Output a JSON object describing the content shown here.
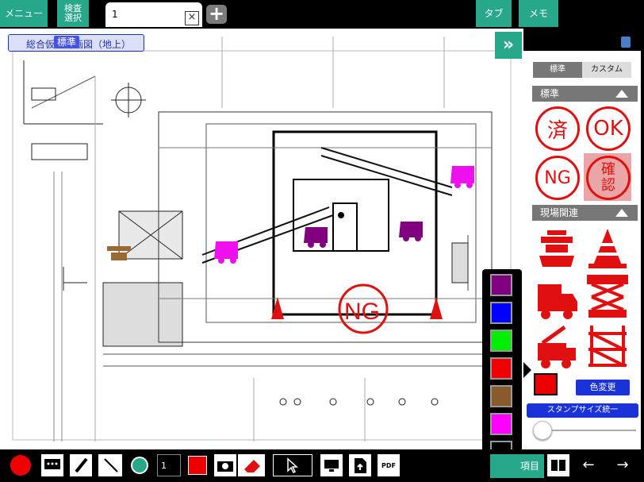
{
  "topbar": {
    "menu_label": "メニュー",
    "inspect_label": "検査\n選択",
    "tab_label": "1",
    "tab_close": "×",
    "tabs_label": "タブ",
    "memo_label": "メモ"
  },
  "document": {
    "title": "総合仮設計画図（地上）",
    "badge": "標準"
  },
  "panel": {
    "segment_standard": "標準",
    "segment_custom": "カスタム",
    "section_standard": "標準",
    "section_site": "現場関連",
    "stamps_standard": [
      "済",
      "OK",
      "NG",
      "確\n認"
    ],
    "stamps_site": [
      "safety-person-icon",
      "traffic-cone-icon",
      "crane-truck-icon",
      "scissor-lift-icon",
      "mobile-crane-icon",
      "scaffold-icon"
    ],
    "color_change": "色変更",
    "size_unify": "スタンプサイズ統一"
  },
  "palette": {
    "colors": [
      "#800080",
      "#0000ff",
      "#00ee00",
      "#ee0000",
      "#8b5a2b",
      "#ff00ff",
      "#000000"
    ],
    "selected": "#ee0000"
  },
  "bottombar": {
    "line_width_label": "1",
    "item_label": "項目",
    "pdf_label": "PDF"
  }
}
